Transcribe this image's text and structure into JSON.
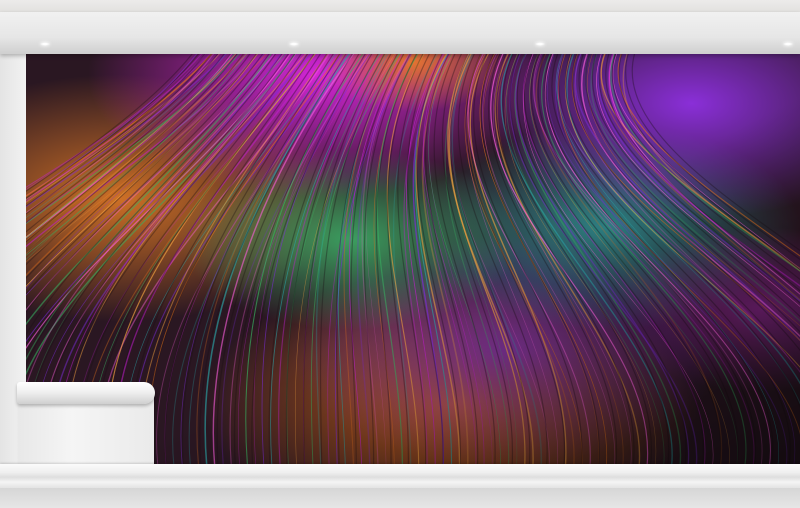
{
  "scene": {
    "subject": "mural",
    "palette": {
      "magenta": "#c21fd0",
      "violet": "#7b2bd6",
      "orange": "#e0701e",
      "green": "#38b060",
      "teal": "#2aa6a8",
      "dark": "#1a0d14",
      "wall": "#ececec"
    }
  }
}
